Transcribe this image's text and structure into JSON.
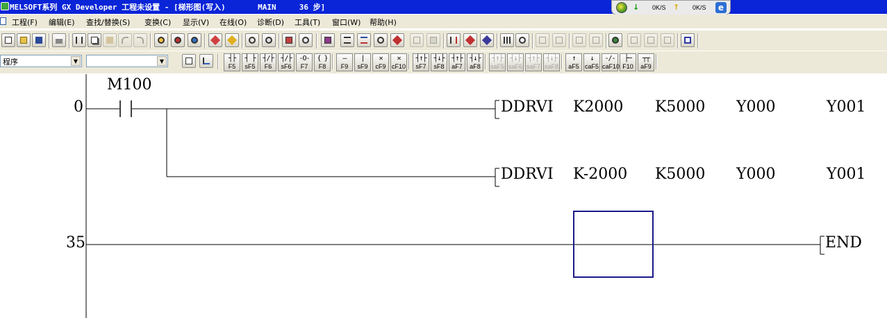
{
  "window": {
    "title": "MELSOFT系列 GX Developer 工程未设置 - [梯形图(写入)       MAIN     36 步]"
  },
  "net_widget": {
    "down_rate": "0K/S",
    "up_rate": "0K/S"
  },
  "menu": [
    {
      "label": "工程(F)"
    },
    {
      "label": "编辑(E)"
    },
    {
      "label": "查找/替换(S)"
    },
    {
      "label": "变换(C)"
    },
    {
      "label": "显示(V)"
    },
    {
      "label": "在线(O)"
    },
    {
      "label": "诊断(D)"
    },
    {
      "label": "工具(T)"
    },
    {
      "label": "窗口(W)"
    },
    {
      "label": "帮助(H)"
    }
  ],
  "toolbar2": {
    "program_combo": "程序",
    "second_combo": ""
  },
  "fkeys": [
    {
      "symbol": "┤├",
      "key": "F5"
    },
    {
      "symbol": "┤ ├",
      "key": "sF5"
    },
    {
      "symbol": "┤/├",
      "key": "F6"
    },
    {
      "symbol": "┤/├",
      "key": "sF6"
    },
    {
      "symbol": "-O-",
      "key": "F7"
    },
    {
      "symbol": "{ }",
      "key": "F8"
    },
    {
      "symbol": "—",
      "key": "F9"
    },
    {
      "symbol": "|",
      "key": "sF9"
    },
    {
      "symbol": "✕",
      "key": "cF9"
    },
    {
      "symbol": "✕",
      "key": "cF10"
    },
    {
      "symbol": "┤↑├",
      "key": "sF7"
    },
    {
      "symbol": "┤↓├",
      "key": "sF8"
    },
    {
      "symbol": "┤↑├",
      "key": "aF7"
    },
    {
      "symbol": "┤↓├",
      "key": "aF8"
    },
    {
      "symbol": "┤↑├",
      "key": "saF5"
    },
    {
      "symbol": "┤↓├",
      "key": "saF6"
    },
    {
      "symbol": "┤↑├",
      "key": "saF7"
    },
    {
      "symbol": "┤↓├",
      "key": "saF8"
    },
    {
      "symbol": "↑",
      "key": "aF5"
    },
    {
      "symbol": "↓",
      "key": "caF5"
    },
    {
      "symbol": "-/-",
      "key": "caF10"
    },
    {
      "symbol": "├─",
      "key": "F10"
    },
    {
      "symbol": "┬┬",
      "key": "aF9"
    }
  ],
  "ladder": {
    "rungs": [
      {
        "step": "0",
        "contact": "M100",
        "instructions": [
          {
            "mnemonic": "DDRVI",
            "operands": [
              "K2000",
              "K5000",
              "Y000",
              "Y001"
            ]
          },
          {
            "mnemonic": "DDRVI",
            "operands": [
              "K-2000",
              "K5000",
              "Y000",
              "Y001"
            ]
          }
        ]
      },
      {
        "step": "35",
        "instructions": [
          {
            "mnemonic": "END",
            "operands": []
          }
        ]
      }
    ],
    "cursor_color": "#1a1a8a",
    "line_color": "#000000"
  }
}
